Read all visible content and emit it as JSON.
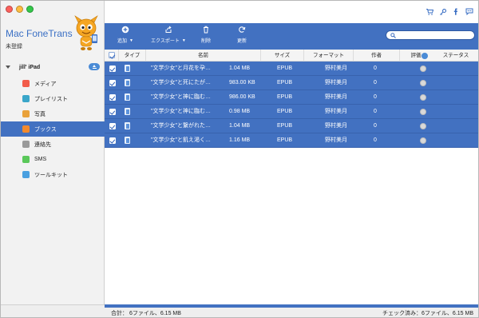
{
  "app": {
    "name": "Mac FoneTrans",
    "registration_status": "未登録"
  },
  "device": {
    "name": "jill' iPad"
  },
  "sidebar": {
    "items": [
      {
        "label": "メディア",
        "icon": "music-icon",
        "color": "#f25c4a"
      },
      {
        "label": "プレイリスト",
        "icon": "playlist-icon",
        "color": "#3aa6c9"
      },
      {
        "label": "写真",
        "icon": "photos-icon",
        "color": "#e9a23b"
      },
      {
        "label": "ブックス",
        "icon": "books-icon",
        "color": "#f28a2e",
        "active": true
      },
      {
        "label": "連絡先",
        "icon": "contacts-icon",
        "color": "#9a9a9a"
      },
      {
        "label": "SMS",
        "icon": "sms-icon",
        "color": "#5ac85a"
      },
      {
        "label": "ツールキット",
        "icon": "toolkit-icon",
        "color": "#4aa0e0"
      }
    ]
  },
  "toolbar": {
    "add_label": "追加",
    "export_label": "エクスポート",
    "delete_label": "削除",
    "refresh_label": "更新"
  },
  "search": {
    "placeholder": ""
  },
  "table": {
    "columns": {
      "type": "タイプ",
      "name": "名前",
      "size": "サイズ",
      "format": "フォーマット",
      "author": "作者",
      "rating": "評価",
      "status": "ステータス"
    },
    "rows": [
      {
        "name": "\"文学少女\"と月花を孕…",
        "size": "1.04 MB",
        "format": "EPUB",
        "author": "野村美月",
        "rating": "0"
      },
      {
        "name": "\"文学少女\"と死にたが…",
        "size": "983.00 KB",
        "format": "EPUB",
        "author": "野村美月",
        "rating": "0"
      },
      {
        "name": "\"文学少女\"と神に臨む…",
        "size": "986.00 KB",
        "format": "EPUB",
        "author": "野村美月",
        "rating": "0"
      },
      {
        "name": "\"文学少女\"と神に臨む…",
        "size": "0.98 MB",
        "format": "EPUB",
        "author": "野村美月",
        "rating": "0"
      },
      {
        "name": "\"文学少女\"と繋がれた…",
        "size": "1.04 MB",
        "format": "EPUB",
        "author": "野村美月",
        "rating": "0"
      },
      {
        "name": "\"文学少女\"と飢え渇く…",
        "size": "1.16 MB",
        "format": "EPUB",
        "author": "野村美月",
        "rating": "0"
      }
    ]
  },
  "status": {
    "total": "合計： 6ファイル、6.15 MB",
    "checked": "チェック済み：6ファイル、6.15 MB"
  },
  "colors": {
    "accent": "#4271c1",
    "brand_text": "#3a6fc4"
  }
}
